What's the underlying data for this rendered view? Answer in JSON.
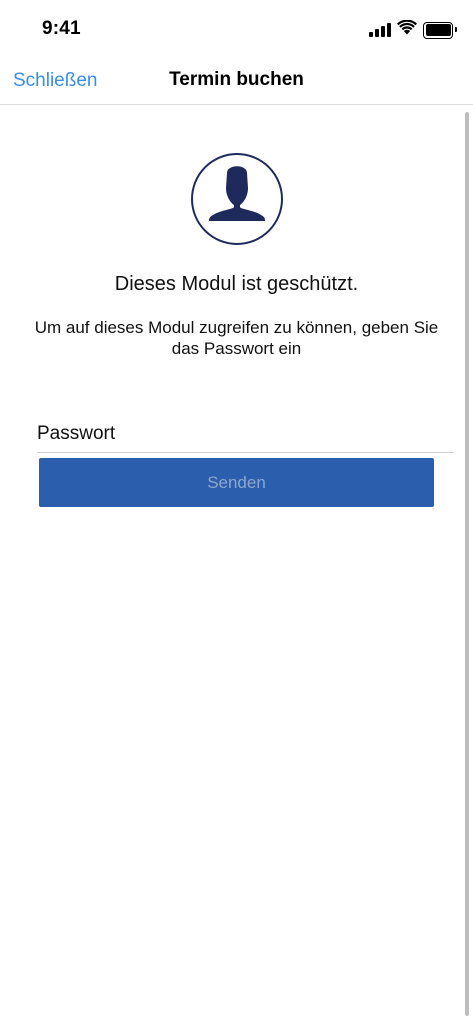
{
  "status_bar": {
    "time": "9:41",
    "icons": [
      "signal-icon",
      "wifi-icon",
      "battery-icon"
    ]
  },
  "nav": {
    "close_label": "Schließen",
    "title": "Termin buchen"
  },
  "content": {
    "avatar_icon": "user-silhouette-icon",
    "heading": "Dieses Modul ist geschützt.",
    "description": "Um auf dieses Modul zugreifen zu können, geben Sie das Passwort ein",
    "password_placeholder": "Passwort",
    "password_value": "",
    "submit_label": "Senden"
  },
  "colors": {
    "link": "#3a8ee6",
    "button": "#2b5fae",
    "button_text_disabled": "#8ea6cc",
    "avatar": "#1f2a5c"
  }
}
